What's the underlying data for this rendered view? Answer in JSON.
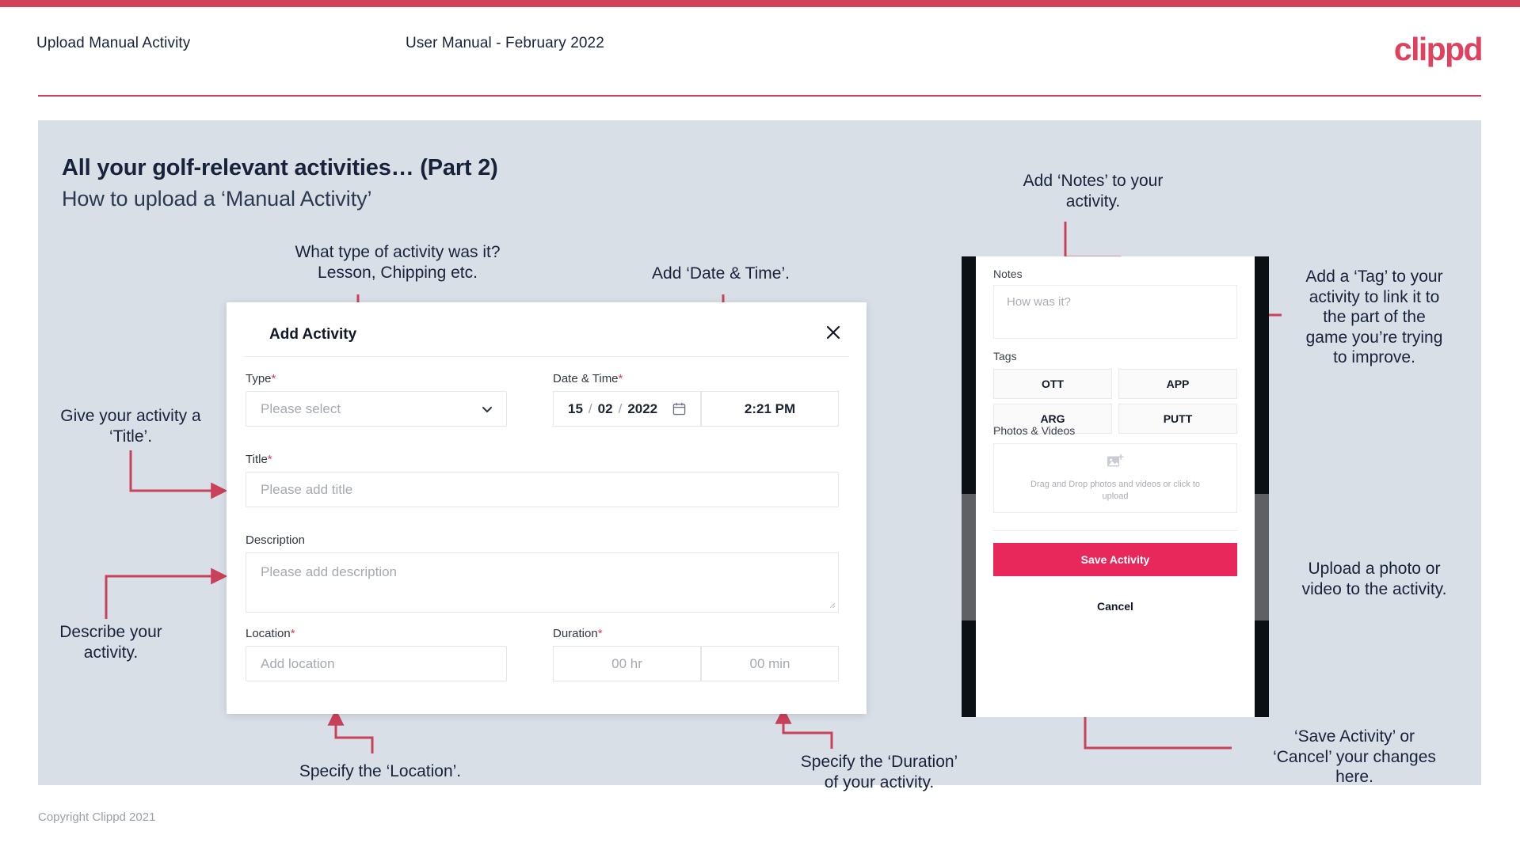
{
  "header": {
    "title": "Upload Manual Activity",
    "subtitle": "User Manual - February 2022",
    "logo": "clippd",
    "accent": "#d14257"
  },
  "slide": {
    "heading": "All your golf-relevant activities… (Part 2)",
    "subheading": "How to upload a ‘Manual Activity’",
    "background": "#d9dfe7"
  },
  "footer": {
    "copyright": "Copyright Clippd 2021"
  },
  "annotations": {
    "type": "What type of activity was it?\nLesson, Chipping etc.",
    "datetime": "Add ‘Date & Time’.",
    "title": "Give your activity a\n‘Title’.",
    "description": "Describe your\nactivity.",
    "location": "Specify the ‘Location’.",
    "duration": "Specify the ‘Duration’\nof your activity.",
    "notes": "Add ‘Notes’ to your\nactivity.",
    "tags": "Add a ‘Tag’ to your\nactivity to link it to\nthe part of the\ngame you’re trying\nto improve.",
    "upload": "Upload a photo or\nvideo to the activity.",
    "save": "‘Save Activity’ or\n‘Cancel’ your changes\nhere.",
    "arrow_color": "#c9415a"
  },
  "dialog": {
    "title": "Add Activity",
    "close_icon": "close-icon",
    "fields": {
      "type": {
        "label": "Type",
        "required": "*",
        "placeholder": "Please select",
        "icon": "chevron-down-icon"
      },
      "datetime": {
        "label": "Date & Time",
        "required": "*",
        "day": "15",
        "month": "02",
        "year": "2022",
        "sep": "/",
        "calendar_icon": "calendar-icon",
        "time": "2:21 PM"
      },
      "title": {
        "label": "Title",
        "required": "*",
        "placeholder": "Please add title"
      },
      "description": {
        "label": "Description",
        "required": "",
        "placeholder": "Please add description"
      },
      "location": {
        "label": "Location",
        "required": "*",
        "placeholder": "Add location"
      },
      "duration": {
        "label": "Duration",
        "required": "*",
        "hours_placeholder": "00 hr",
        "minutes_placeholder": "00 min"
      }
    }
  },
  "phone": {
    "notes": {
      "label": "Notes",
      "placeholder": "How was it?"
    },
    "tags": {
      "label": "Tags",
      "items": [
        "OTT",
        "APP",
        "ARG",
        "PUTT"
      ]
    },
    "photos": {
      "label": "Photos & Videos",
      "icon": "add-image-icon",
      "dropzone_text": "Drag and Drop photos and videos or click to upload"
    },
    "save_label": "Save Activity",
    "cancel_label": "Cancel",
    "save_color": "#e8275a"
  }
}
